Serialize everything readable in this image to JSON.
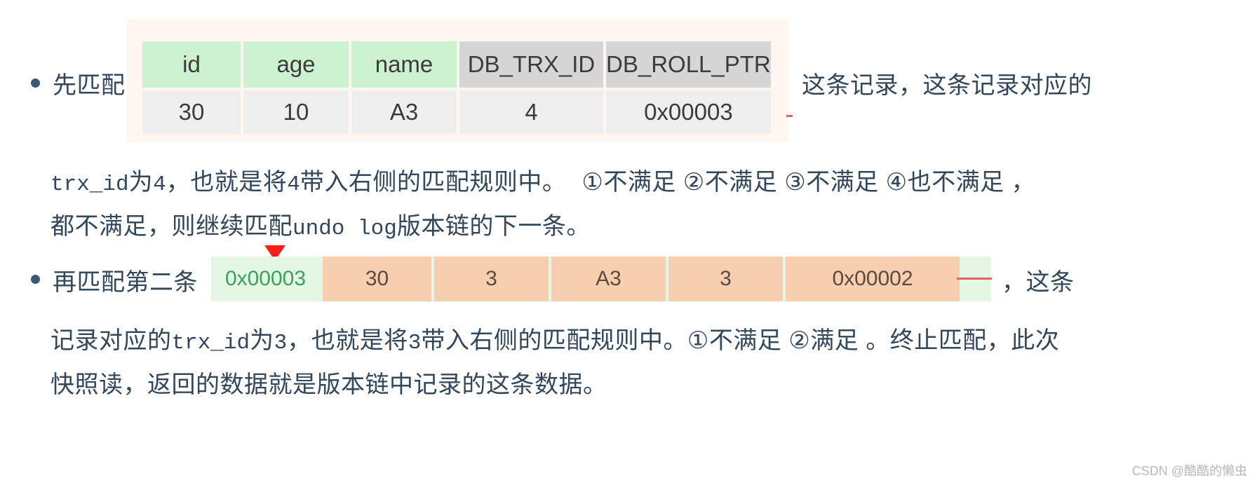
{
  "colors": {
    "text": "#33475b",
    "header_green": "#ccf2cf",
    "header_grey": "#d6d6d6",
    "cell_grey": "#efefef",
    "shot_bg": "#fdf7f0",
    "row_orange": "#f8cfae",
    "row_green": "#e4f6e4",
    "marker_red": "#ff1a1a",
    "watermark": "#b8b8b8"
  },
  "bullets": {
    "first": {
      "prefix": "先匹配",
      "suffix": "这条记录，这条记录对应的",
      "line2_mono": "trx_id",
      "line2_a": "为",
      "line2_num1": "4",
      "line2_b": "，也就是将",
      "line2_num2": "4",
      "line2_c": "带入右侧的匹配规则中。",
      "line2_conditions": "①不满足 ②不满足 ③不满足 ④也不满足 ，",
      "line3_a": "都不满足，则继续匹配",
      "line3_mono": "undo log",
      "line3_b": "版本链的下一条。"
    },
    "second": {
      "prefix": "再匹配第二条",
      "suffix": "，这条",
      "line2_a": "记录对应的",
      "line2_mono": "trx_id",
      "line2_b": "为",
      "line2_num": "3",
      "line2_c": "，也就是将",
      "line2_num2": "3",
      "line2_d": "带入右侧的匹配规则中。①不满足 ②满足 。终止匹配，此次",
      "line3": "快照读，返回的数据就是版本链中记录的这条数据。"
    }
  },
  "table_top": {
    "headers": [
      "id",
      "age",
      "name",
      "DB_TRX_ID",
      "DB_ROLL_PTR"
    ],
    "rows": [
      [
        "30",
        "10",
        "A3",
        "4",
        "0x00003"
      ]
    ]
  },
  "table_bottom": {
    "cells": [
      "0x00003",
      "30",
      "3",
      "A3",
      "3",
      "0x00002"
    ]
  },
  "watermark": "CSDN @酷酷的懒虫"
}
